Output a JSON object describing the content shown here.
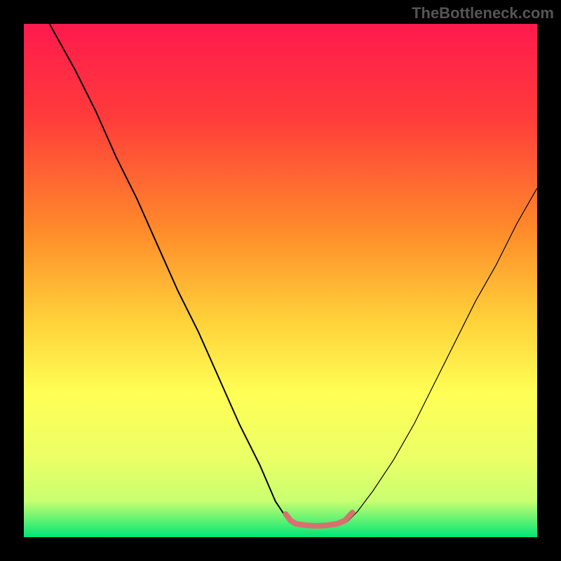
{
  "watermark": "TheBottleneck.com",
  "chart_data": {
    "type": "line",
    "title": "",
    "xlabel": "",
    "ylabel": "",
    "xlim": [
      0,
      100
    ],
    "ylim": [
      0,
      100
    ],
    "grid": false,
    "legend": false,
    "gradient_stops": [
      {
        "offset": 0,
        "color": "#ff1a4d"
      },
      {
        "offset": 18,
        "color": "#ff3b3b"
      },
      {
        "offset": 40,
        "color": "#ff8a2a"
      },
      {
        "offset": 58,
        "color": "#ffd23a"
      },
      {
        "offset": 72,
        "color": "#ffff55"
      },
      {
        "offset": 85,
        "color": "#eaff66"
      },
      {
        "offset": 93,
        "color": "#c8ff70"
      },
      {
        "offset": 100,
        "color": "#00e676"
      }
    ],
    "series": [
      {
        "name": "left-curve",
        "stroke": "#000000",
        "stroke_width": 2,
        "points": [
          {
            "x": 5,
            "y": 100
          },
          {
            "x": 10,
            "y": 91
          },
          {
            "x": 14,
            "y": 83
          },
          {
            "x": 18,
            "y": 74
          },
          {
            "x": 22,
            "y": 66
          },
          {
            "x": 26,
            "y": 57
          },
          {
            "x": 30,
            "y": 48
          },
          {
            "x": 34,
            "y": 40
          },
          {
            "x": 38,
            "y": 31
          },
          {
            "x": 42,
            "y": 22
          },
          {
            "x": 46,
            "y": 14
          },
          {
            "x": 49,
            "y": 7
          },
          {
            "x": 51,
            "y": 4
          },
          {
            "x": 52,
            "y": 3
          }
        ]
      },
      {
        "name": "right-curve",
        "stroke": "#000000",
        "stroke_width": 1.2,
        "points": [
          {
            "x": 63,
            "y": 3
          },
          {
            "x": 65,
            "y": 5
          },
          {
            "x": 68,
            "y": 9
          },
          {
            "x": 72,
            "y": 15
          },
          {
            "x": 76,
            "y": 22
          },
          {
            "x": 80,
            "y": 30
          },
          {
            "x": 84,
            "y": 38
          },
          {
            "x": 88,
            "y": 46
          },
          {
            "x": 92,
            "y": 53
          },
          {
            "x": 96,
            "y": 61
          },
          {
            "x": 100,
            "y": 68
          }
        ]
      },
      {
        "name": "optimal-zone",
        "stroke": "#d87070",
        "stroke_width": 8,
        "linecap": "round",
        "points": [
          {
            "x": 51,
            "y": 4.5
          },
          {
            "x": 52,
            "y": 3.2
          },
          {
            "x": 53,
            "y": 2.6
          },
          {
            "x": 55,
            "y": 2.3
          },
          {
            "x": 57,
            "y": 2.2
          },
          {
            "x": 59,
            "y": 2.3
          },
          {
            "x": 61,
            "y": 2.6
          },
          {
            "x": 62.5,
            "y": 3.2
          },
          {
            "x": 64,
            "y": 4.8
          }
        ]
      }
    ]
  }
}
